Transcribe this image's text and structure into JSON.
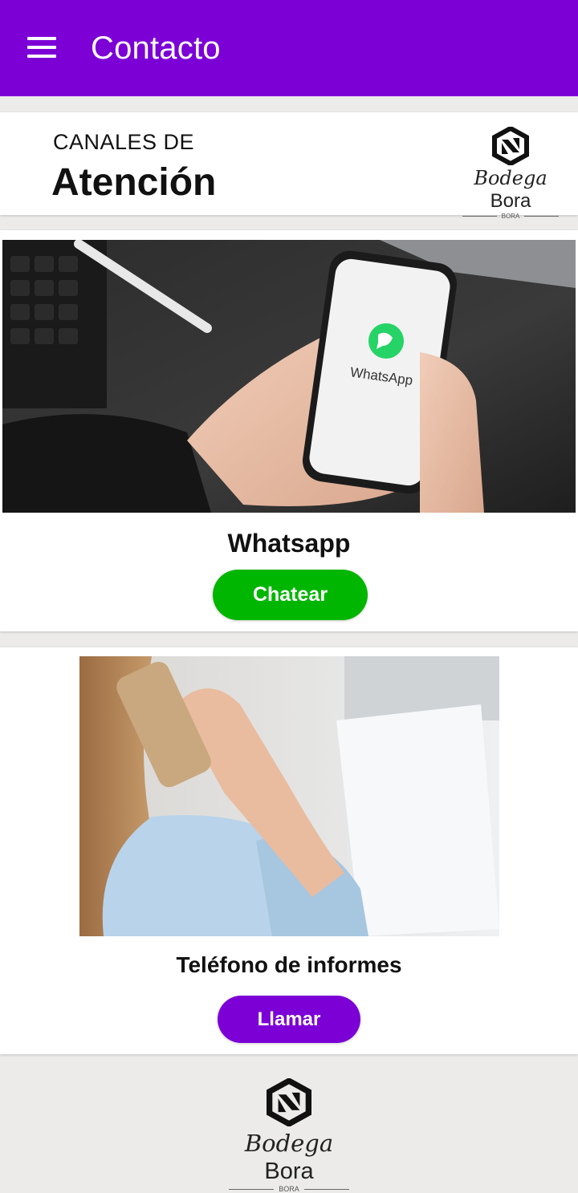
{
  "appbar": {
    "title": "Contacto",
    "menu_icon": "hamburger-menu-icon",
    "color": "#7c00d6"
  },
  "header": {
    "subtitle": "CANALES DE",
    "title": "Atención"
  },
  "brand": {
    "name_part1": "Bodega",
    "name_part2": "Bora",
    "tagline": "BORA"
  },
  "whatsapp": {
    "title": "Whatsapp",
    "button_label": "Chatear",
    "button_color": "#00b600",
    "phone_text": "WhatsApp"
  },
  "telefono": {
    "title": "Teléfono de informes",
    "button_label": "Llamar",
    "button_color": "#7c00d6"
  },
  "footer_brand": {
    "name_part1": "Bodega",
    "name_part2": "Bora",
    "tagline": "BORA"
  }
}
